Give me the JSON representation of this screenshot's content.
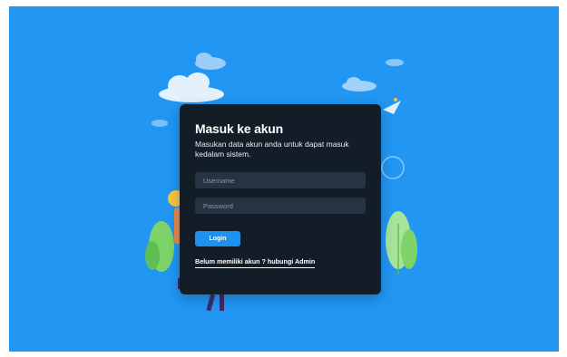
{
  "login_card": {
    "title": "Masuk ke akun",
    "subtitle": "Masukan data akun anda untuk dapat masuk kedalam sistem.",
    "username_placeholder": "Username",
    "password_placeholder": "Password",
    "login_label": "Login",
    "signup_link": "Belum memiliki akun ? hubungi Admin"
  },
  "colors": {
    "background": "#2196f3",
    "card": "#131d28",
    "input": "#263342",
    "button": "#1e90f0"
  }
}
